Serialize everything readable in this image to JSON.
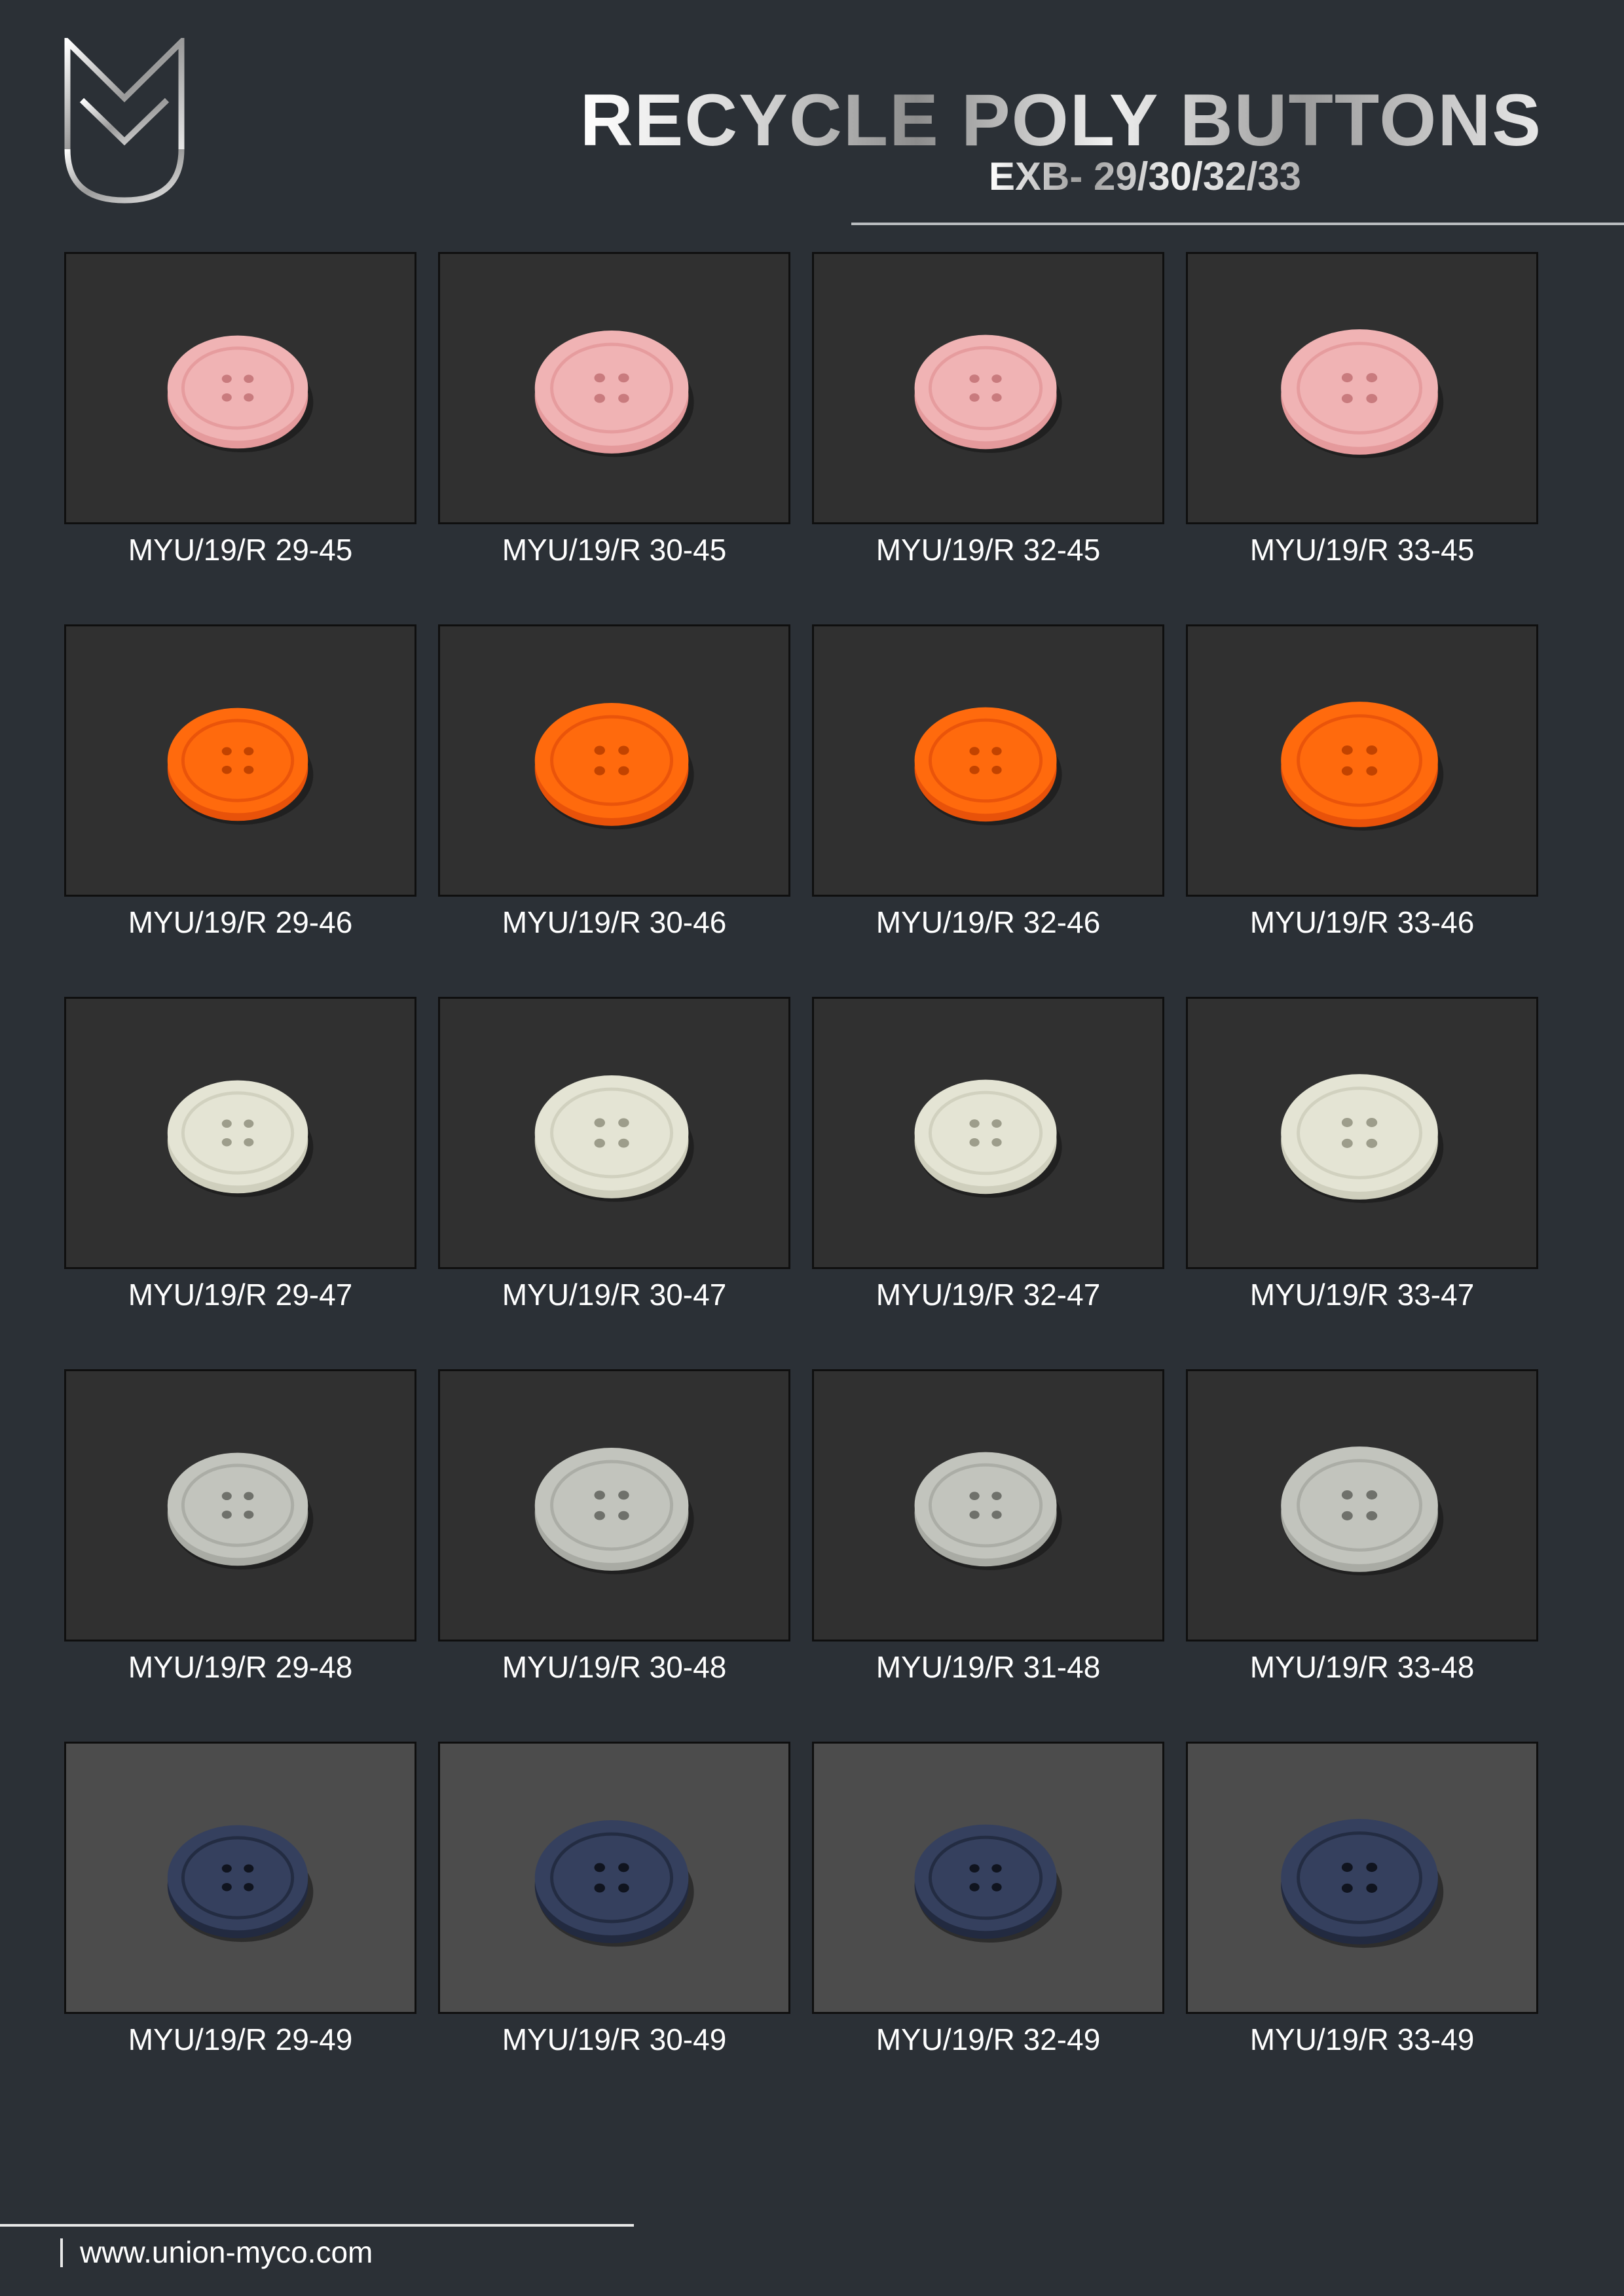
{
  "header": {
    "title": "RECYCLE POLY BUTTONS",
    "subtitle": "EXB- 29/30/32/33",
    "logo_icon": "myu-monogram-logo"
  },
  "colors": {
    "background": "#2b3036",
    "pink": "#f0b3b4",
    "orange": "#ff6a0d",
    "cream": "#e4e4d4",
    "grey": "#c2c4bd",
    "navy": "#35405e"
  },
  "products": [
    {
      "code": "MYU/19/R 29-45",
      "color": "pink"
    },
    {
      "code": "MYU/19/R 30-45",
      "color": "pink"
    },
    {
      "code": "MYU/19/R 32-45",
      "color": "pink"
    },
    {
      "code": "MYU/19/R 33-45",
      "color": "pink"
    },
    {
      "code": "MYU/19/R 29-46",
      "color": "orange"
    },
    {
      "code": "MYU/19/R 30-46",
      "color": "orange"
    },
    {
      "code": "MYU/19/R 32-46",
      "color": "orange"
    },
    {
      "code": "MYU/19/R 33-46",
      "color": "orange"
    },
    {
      "code": "MYU/19/R 29-47",
      "color": "cream"
    },
    {
      "code": "MYU/19/R 30-47",
      "color": "cream"
    },
    {
      "code": "MYU/19/R 32-47",
      "color": "cream"
    },
    {
      "code": "MYU/19/R 33-47",
      "color": "cream"
    },
    {
      "code": "MYU/19/R 29-48",
      "color": "grey"
    },
    {
      "code": "MYU/19/R 30-48",
      "color": "grey"
    },
    {
      "code": "MYU/19/R 31-48",
      "color": "grey"
    },
    {
      "code": "MYU/19/R 33-48",
      "color": "grey"
    },
    {
      "code": "MYU/19/R 29-49",
      "color": "navy"
    },
    {
      "code": "MYU/19/R 30-49",
      "color": "navy"
    },
    {
      "code": "MYU/19/R 32-49",
      "color": "navy"
    },
    {
      "code": "MYU/19/R 33-49",
      "color": "navy"
    }
  ],
  "footer": {
    "url": "www.union-myco.com"
  }
}
